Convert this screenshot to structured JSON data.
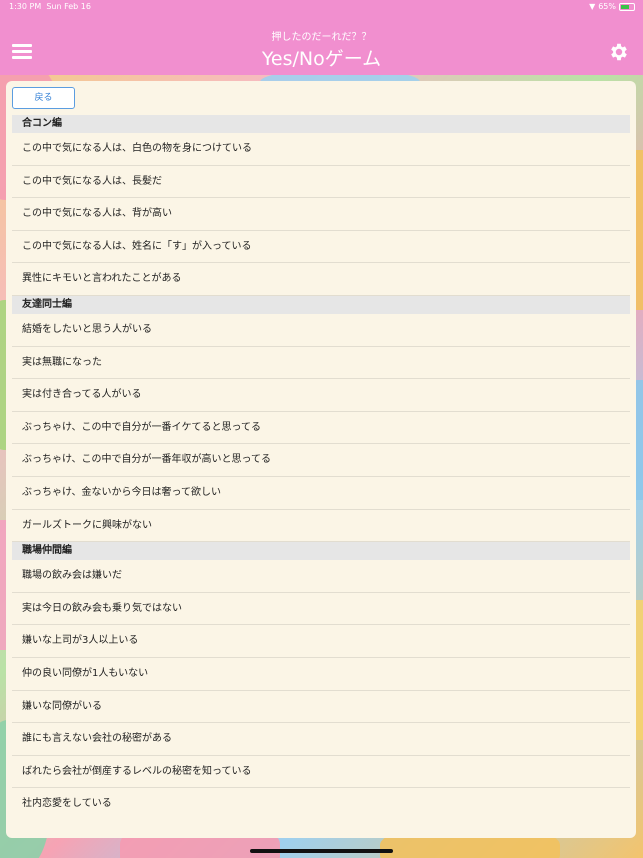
{
  "status": {
    "time": "1:30 PM",
    "date": "Sun Feb 16",
    "battery": "65%"
  },
  "nav": {
    "subtitle": "押したのだーれだ？？",
    "title": "Yes/Noゲーム"
  },
  "back_label": "戻る",
  "sections": [
    {
      "title": "合コン編",
      "items": [
        "この中で気になる人は、白色の物を身につけている",
        "この中で気になる人は、長髪だ",
        "この中で気になる人は、背が高い",
        "この中で気になる人は、姓名に「す」が入っている",
        "異性にキモいと言われたことがある"
      ]
    },
    {
      "title": "友達同士編",
      "items": [
        "結婚をしたいと思う人がいる",
        "実は無職になった",
        "実は付き合ってる人がいる",
        "ぶっちゃけ、この中で自分が一番イケてると思ってる",
        "ぶっちゃけ、この中で自分が一番年収が高いと思ってる",
        "ぶっちゃけ、金ないから今日は奢って欲しい",
        "ガールズトークに興味がない"
      ]
    },
    {
      "title": "職場仲間編",
      "items": [
        "職場の飲み会は嫌いだ",
        "実は今日の飲み会も乗り気ではない",
        "嫌いな上司が3人以上いる",
        "仲の良い同僚が1人もいない",
        "嫌いな同僚がいる",
        "誰にも言えない会社の秘密がある",
        "ばれたら会社が倒産するレベルの秘密を知っている",
        "社内恋愛をしている"
      ]
    }
  ]
}
